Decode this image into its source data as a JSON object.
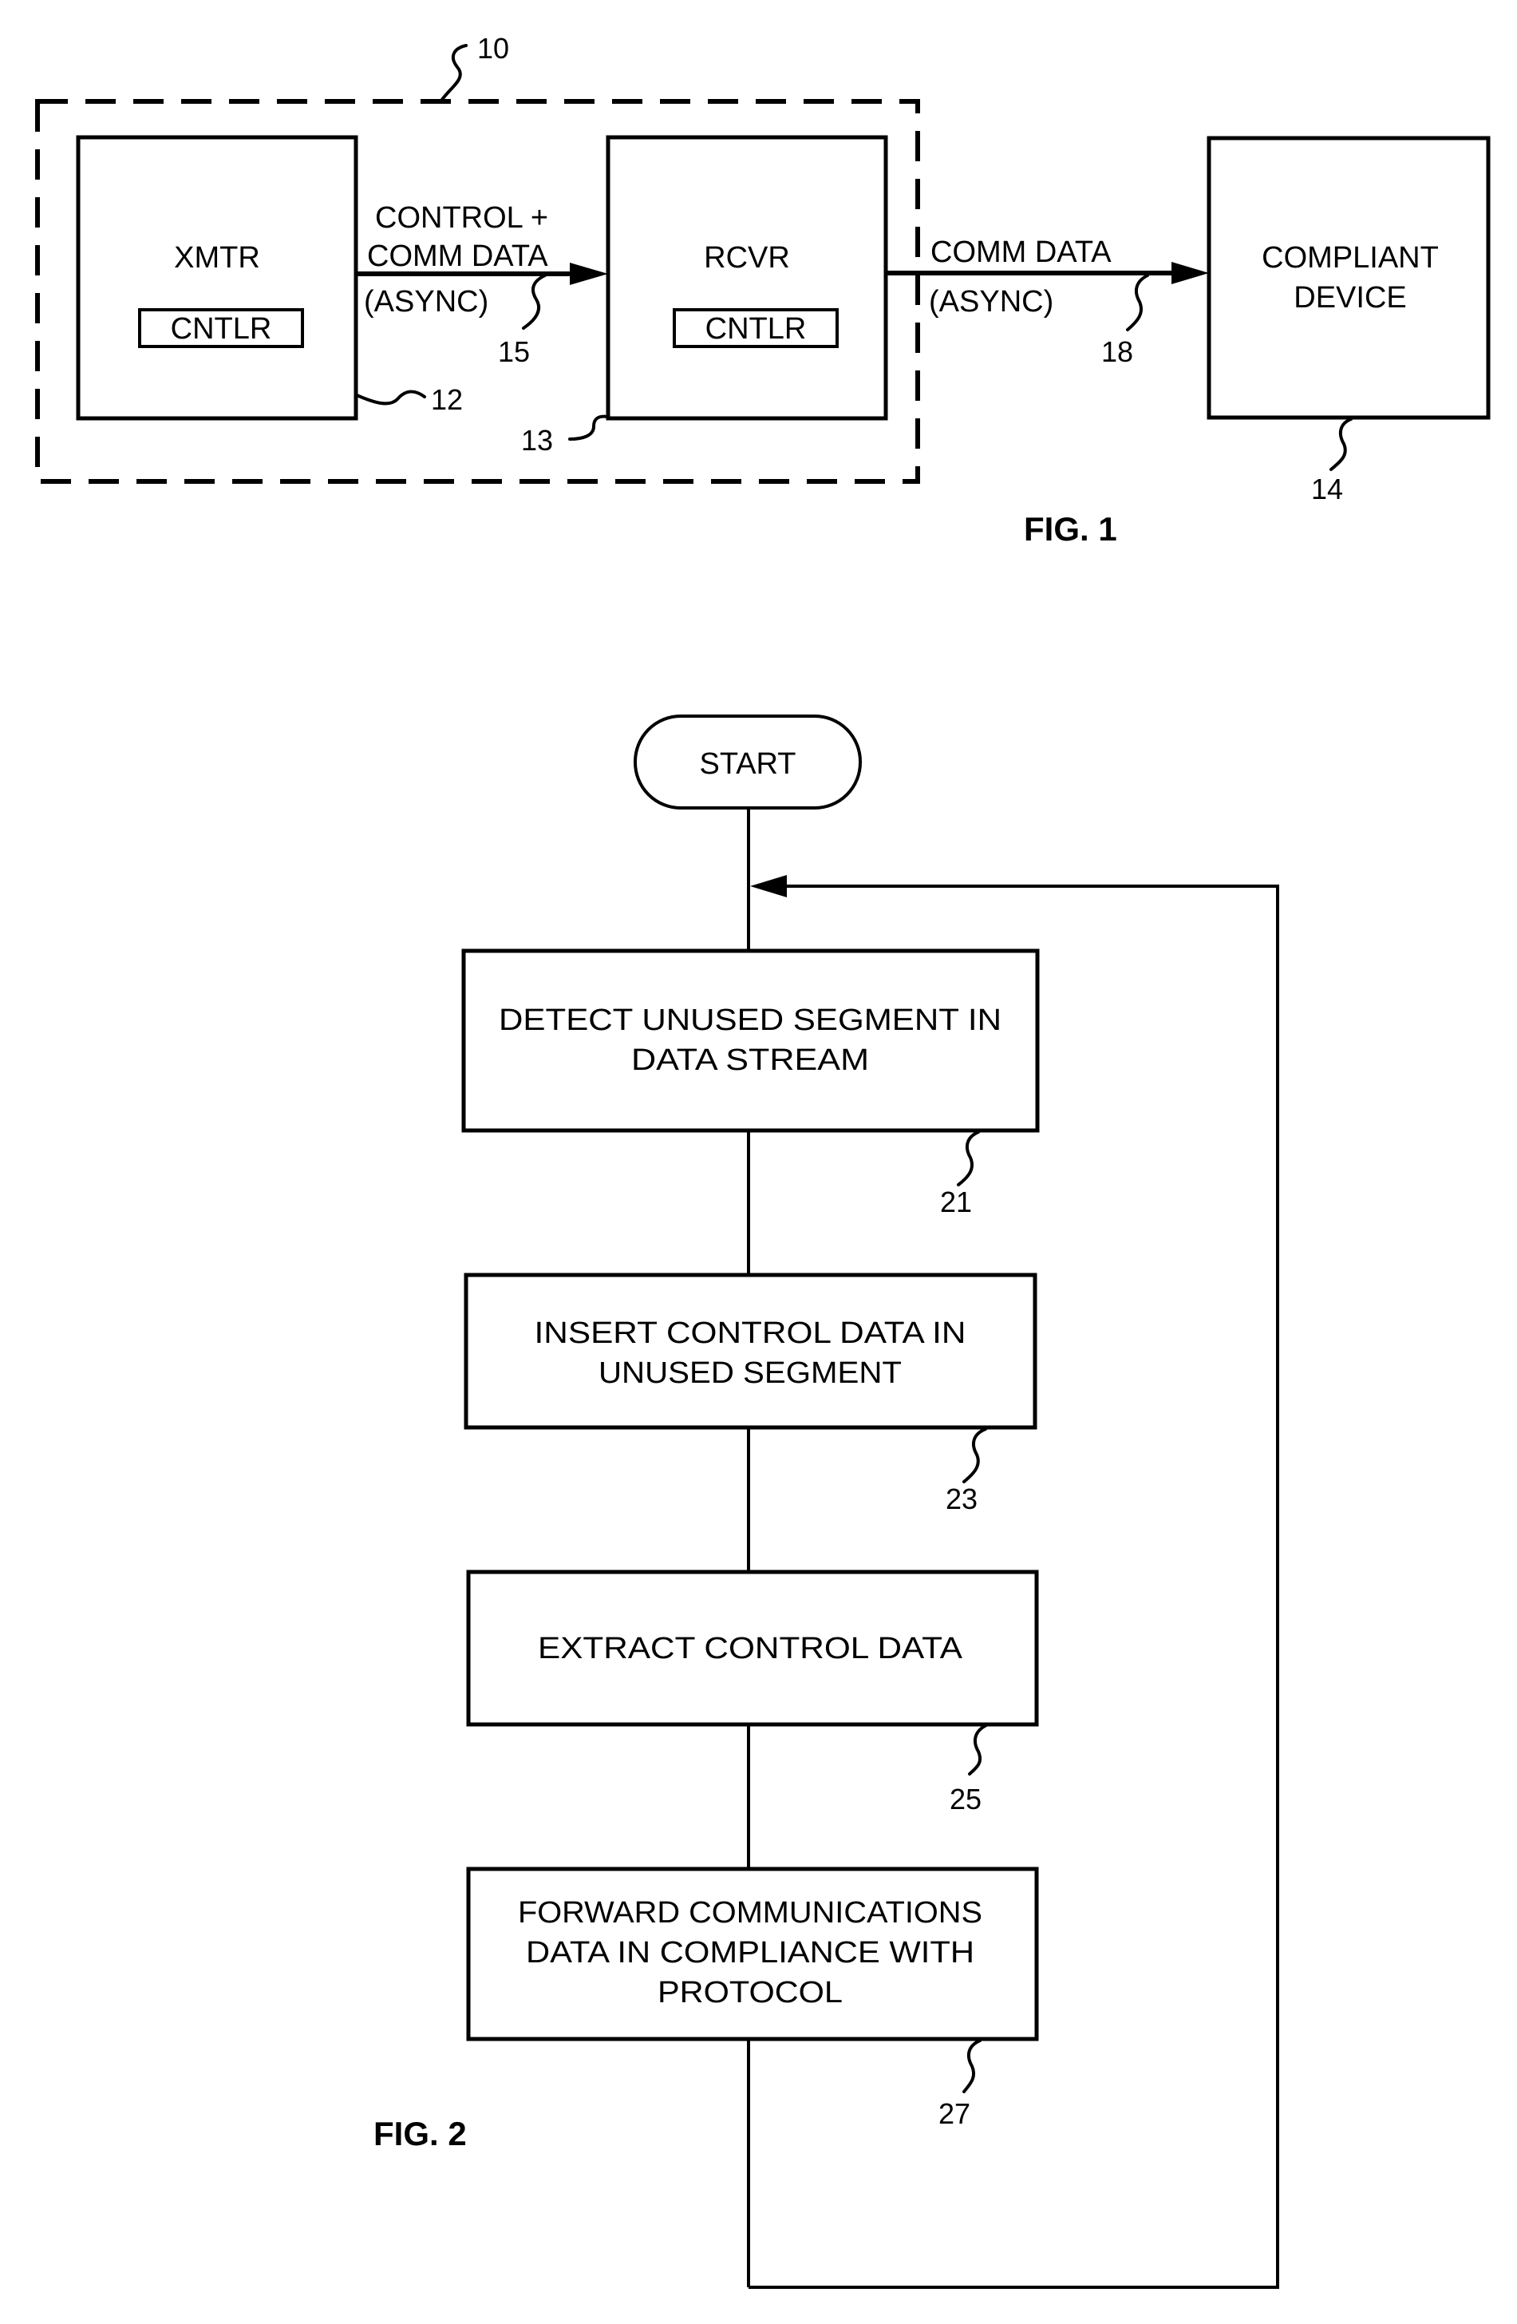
{
  "figure1": {
    "caption": "FIG. 1",
    "system_ref": "10",
    "xmtr": {
      "label": "XMTR",
      "controller": "CNTLR",
      "ref": "12"
    },
    "rcvr": {
      "label": "RCVR",
      "controller": "CNTLR",
      "ref": "13"
    },
    "link_xmtr_rcvr": {
      "line1": "CONTROL +",
      "line2": "COMM DATA",
      "line3": "(ASYNC)",
      "ref": "15"
    },
    "link_rcvr_device": {
      "line1": "COMM DATA",
      "line2": "(ASYNC)",
      "ref": "18"
    },
    "device": {
      "line1": "COMPLIANT",
      "line2": "DEVICE",
      "ref": "14"
    }
  },
  "figure2": {
    "caption": "FIG. 2",
    "start": "START",
    "steps": [
      {
        "lines": [
          "DETECT UNUSED SEGMENT IN",
          "DATA STREAM"
        ],
        "ref": "21"
      },
      {
        "lines": [
          "INSERT CONTROL DATA IN",
          "UNUSED SEGMENT"
        ],
        "ref": "23"
      },
      {
        "lines": [
          "EXTRACT CONTROL DATA"
        ],
        "ref": "25"
      },
      {
        "lines": [
          "FORWARD COMMUNICATIONS",
          "DATA IN COMPLIANCE WITH",
          "PROTOCOL"
        ],
        "ref": "27"
      }
    ]
  }
}
